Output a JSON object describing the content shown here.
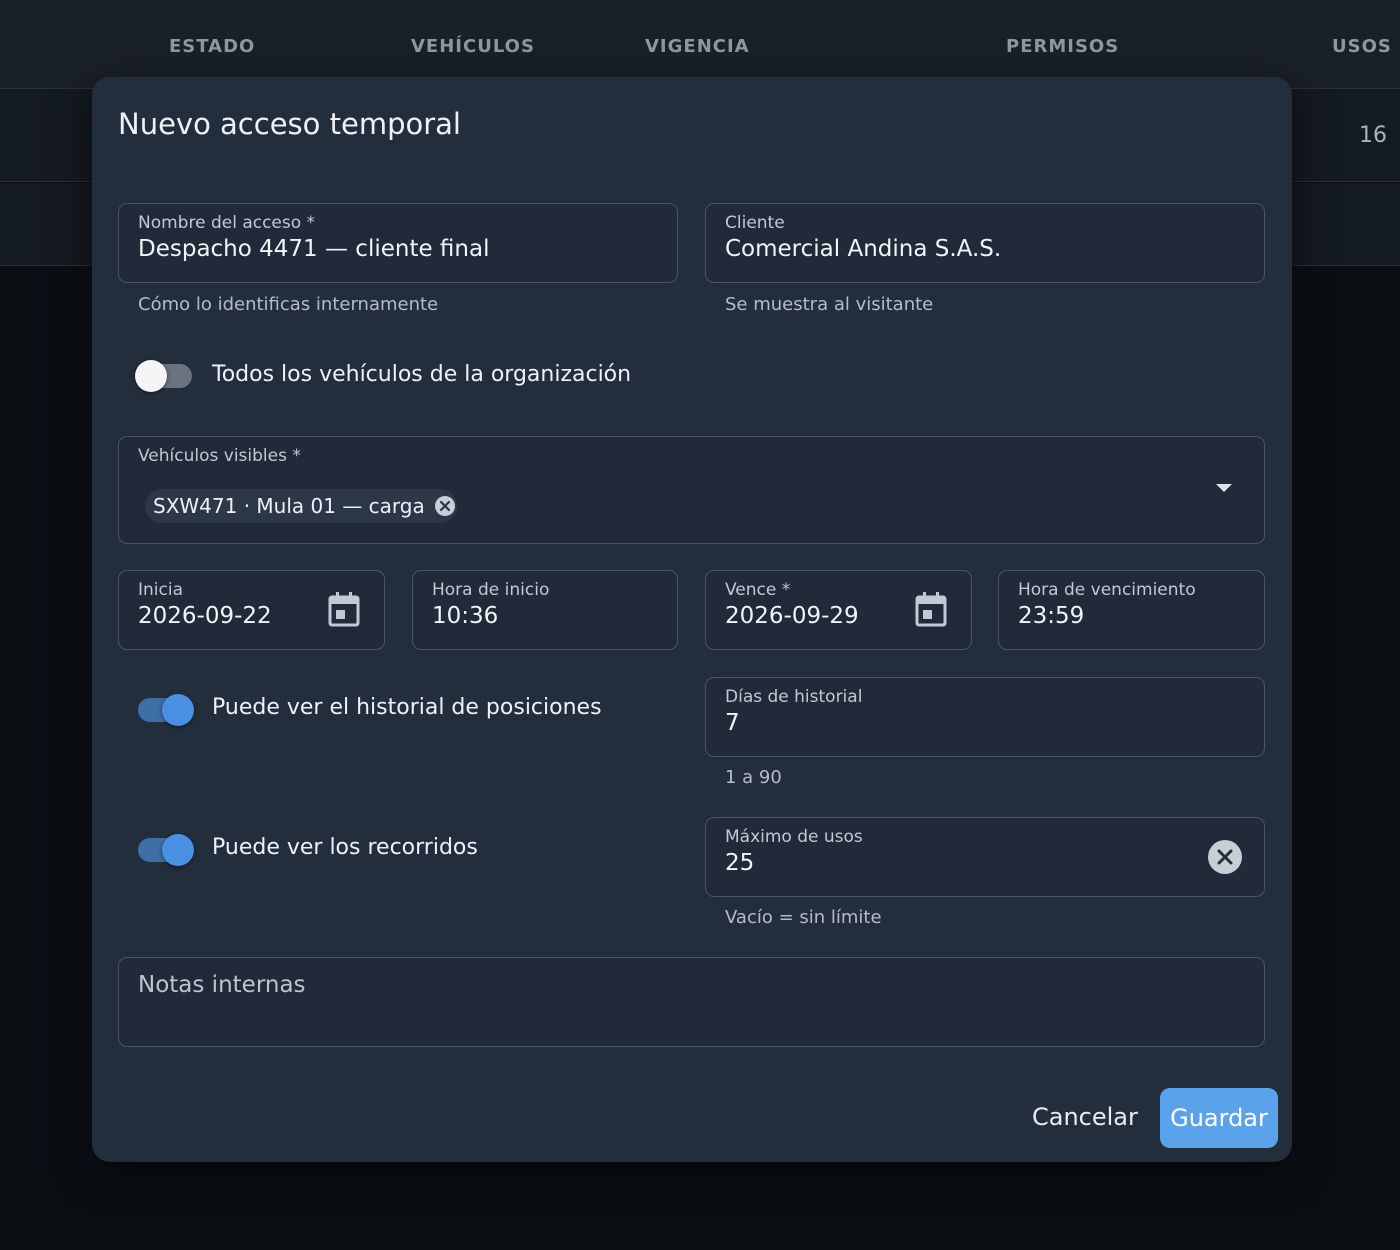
{
  "table": {
    "columns": [
      "ESTADO",
      "VEHÍCULOS",
      "VIGENCIA",
      "PERMISOS",
      "USOS"
    ],
    "row1_usos": "16"
  },
  "modal": {
    "title": "Nuevo acceso temporal",
    "nombre": {
      "label": "Nombre del acceso *",
      "value": "Despacho 4471 — cliente final",
      "helper": "Cómo lo identificas internamente"
    },
    "cliente": {
      "label": "Cliente",
      "value": "Comercial Andina S.A.S.",
      "helper": "Se muestra al visitante"
    },
    "todos_vehiculos": {
      "label": "Todos los vehículos de la organización",
      "checked": false
    },
    "vehiculos": {
      "label": "Vehículos visibles *",
      "chips": [
        "SXW471 · Mula 01 — carga"
      ]
    },
    "inicia": {
      "label": "Inicia",
      "value": "2026-09-22",
      "icon": "calendar-icon"
    },
    "hora_inicio": {
      "label": "Hora de inicio",
      "value": "10:36"
    },
    "vence": {
      "label": "Vence *",
      "value": "2026-09-29",
      "icon": "calendar-icon"
    },
    "hora_vencimiento": {
      "label": "Hora de vencimiento",
      "value": "23:59"
    },
    "historial": {
      "label": "Puede ver el historial de posiciones",
      "checked": true
    },
    "dias_historial": {
      "label": "Días de historial",
      "value": "7",
      "helper": "1 a 90"
    },
    "recorridos": {
      "label": "Puede ver los recorridos",
      "checked": true
    },
    "max_usos": {
      "label": "Máximo de usos",
      "value": "25",
      "helper": "Vacío = sin límite"
    },
    "notas": {
      "placeholder": "Notas internas"
    },
    "buttons": {
      "cancel": "Cancelar",
      "save": "Guardar"
    }
  },
  "colors": {
    "accent": "#5aa3ea",
    "modal_bg": "#232e3d",
    "page_bg": "#0b0f14"
  }
}
